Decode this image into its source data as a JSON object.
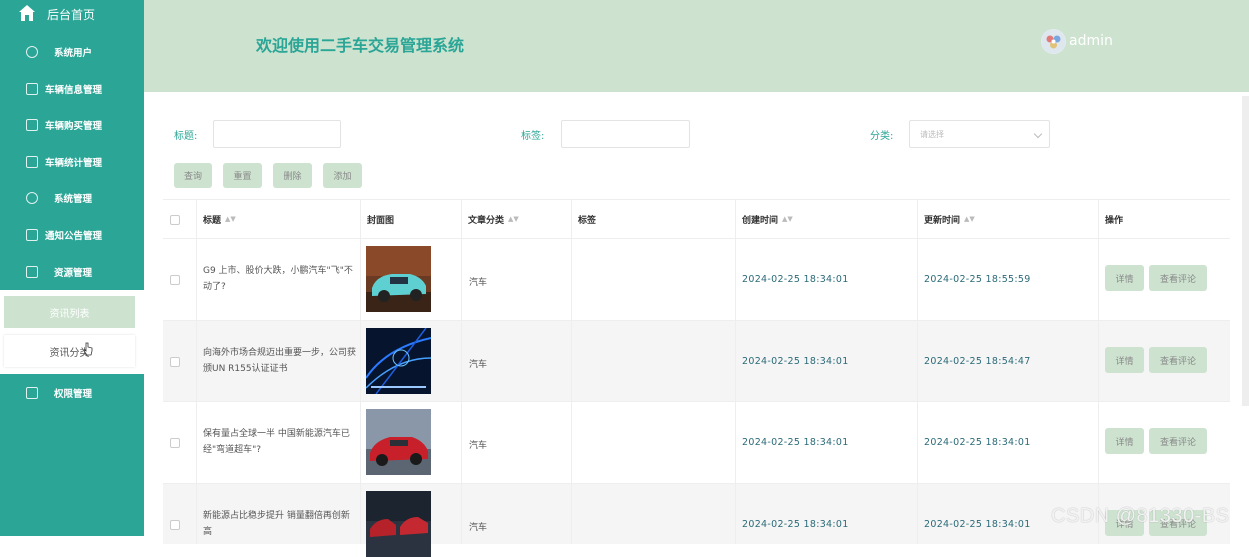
{
  "sidebar": {
    "home_label": "后台首页",
    "items": [
      {
        "label": "系统用户",
        "icon": "cloud-icon"
      },
      {
        "label": "车辆信息管理",
        "icon": "edit-icon"
      },
      {
        "label": "车辆购买管理",
        "icon": "mail-icon"
      },
      {
        "label": "车辆统计管理",
        "icon": "edit-icon"
      },
      {
        "label": "系统管理",
        "icon": "cloud-icon"
      },
      {
        "label": "通知公告管理",
        "icon": "mail-icon"
      },
      {
        "label": "资源管理",
        "icon": "file-icon"
      },
      {
        "label": "权限管理",
        "icon": "edit-icon"
      }
    ],
    "submenu": [
      "资讯列表",
      "资讯分类"
    ]
  },
  "header": {
    "title": "欢迎使用二手车交易管理系统",
    "user": "admin"
  },
  "search": {
    "title_label": "标题:",
    "tag_label": "标签:",
    "category_label": "分类:",
    "category_placeholder": "请选择"
  },
  "actions": {
    "query": "查询",
    "reset": "重置",
    "delete": "删除",
    "add": "添加"
  },
  "table": {
    "columns": [
      "标题",
      "封面图",
      "文章分类",
      "标签",
      "创建时间",
      "更新时间",
      "操作"
    ],
    "rows": [
      {
        "title": "G9 上市、股价大跌，小鹏汽车\"飞\"不动了?",
        "category": "汽车",
        "tag": "",
        "created": "2024-02-25 18:34:01",
        "updated": "2024-02-25 18:55:59"
      },
      {
        "title": "向海外市场合规迈出重要一步，公司获颁UN R155认证证书",
        "category": "汽车",
        "tag": "",
        "created": "2024-02-25 18:34:01",
        "updated": "2024-02-25 18:54:47"
      },
      {
        "title": "保有量占全球一半 中国新能源汽车已经\"弯道超车\"?",
        "category": "汽车",
        "tag": "",
        "created": "2024-02-25 18:34:01",
        "updated": "2024-02-25 18:34:01"
      },
      {
        "title": "新能源占比稳步提升 销量翻倍再创新高",
        "category": "汽车",
        "tag": "",
        "created": "2024-02-25 18:34:01",
        "updated": "2024-02-25 18:34:01"
      }
    ],
    "op_detail": "详情",
    "op_comments": "查看评论"
  },
  "watermark": "CSDN @81330-BS"
}
